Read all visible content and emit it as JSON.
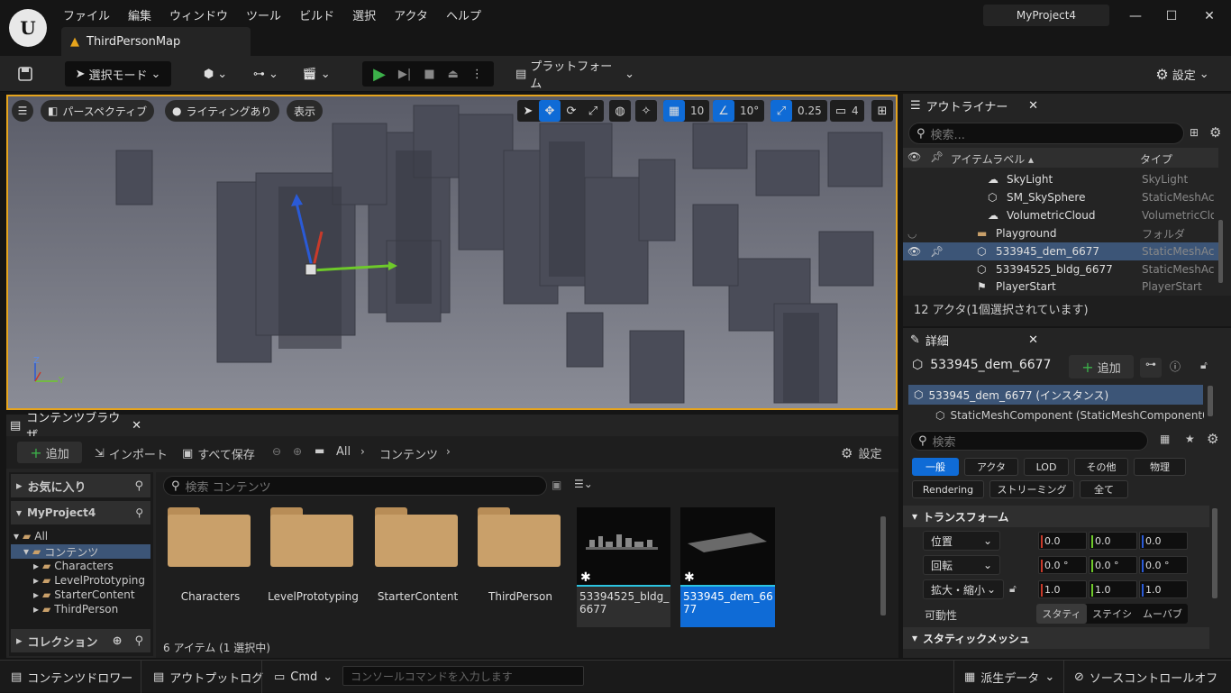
{
  "app": {
    "menu": [
      "ファイル",
      "編集",
      "ウィンドウ",
      "ツール",
      "ビルド",
      "選択",
      "アクタ",
      "ヘルプ"
    ],
    "project": "MyProject4",
    "map_tab": "ThirdPersonMap"
  },
  "toolbar": {
    "mode": "選択モード",
    "platform": "プラットフォーム",
    "settings": "設定"
  },
  "viewport": {
    "perspective": "パースペクティブ",
    "lighting": "ライティングあり",
    "show": "表示",
    "grid_snap": "10",
    "rot_snap": "10°",
    "scale_snap": "0.25",
    "cam_speed": "4",
    "axis_z": "Z",
    "axis_y": "Y"
  },
  "outliner": {
    "title": "アウトライナー",
    "search_placeholder": "検索...",
    "col_label": "アイテムラベル ▴",
    "col_type": "タイプ",
    "rows": [
      {
        "label": "SkyLight",
        "type": "SkyLight"
      },
      {
        "label": "SM_SkySphere",
        "type": "StaticMeshAc"
      },
      {
        "label": "VolumetricCloud",
        "type": "VolumetricClo"
      },
      {
        "label": "Playground",
        "type": "フォルダ"
      },
      {
        "label": "533945_dem_6677",
        "type": "StaticMeshAc"
      },
      {
        "label": "53394525_bldg_6677",
        "type": "StaticMeshAc"
      },
      {
        "label": "PlayerStart",
        "type": "PlayerStart"
      }
    ],
    "status": "12 アクタ(1個選択されています)"
  },
  "details": {
    "title": "詳細",
    "actor": "533945_dem_6677",
    "add": "追加",
    "instance": "533945_dem_6677 (インスタンス)",
    "component": "StaticMeshComponent (StaticMeshComponent0",
    "search_placeholder": "検索",
    "filters": [
      "一般",
      "アクタ",
      "LOD",
      "その他",
      "物理",
      "Rendering",
      "ストリーミング",
      "全て"
    ],
    "transform_header": "トランスフォーム",
    "location_label": "位置",
    "rotation_label": "回転",
    "scale_label": "拡大・縮小",
    "location": [
      "0.0",
      "0.0",
      "0.0"
    ],
    "rotation": [
      "0.0 °",
      "0.0 °",
      "0.0 °"
    ],
    "scale": [
      "1.0",
      "1.0",
      "1.0"
    ],
    "mobility_label": "可動性",
    "mobility": [
      "スタティ",
      "ステイシ",
      "ムーバブ"
    ],
    "static_mesh_header": "スタティックメッシュ"
  },
  "content_browser": {
    "title": "コンテンツブラウザ",
    "add": "追加",
    "import": "インポート",
    "save_all": "すべて保存",
    "path_all": "All",
    "path_content": "コンテンツ",
    "settings": "設定",
    "favorites": "お気に入り",
    "project": "MyProject4",
    "tree": [
      "All",
      "コンテンツ",
      "Characters",
      "LevelPrototyping",
      "StarterContent",
      "ThirdPerson"
    ],
    "collections": "コレクション",
    "search_placeholder": "検索 コンテンツ",
    "items": [
      "Characters",
      "LevelPrototyping",
      "StarterContent",
      "ThirdPerson",
      "53394525_bldg_6677",
      "533945_dem_6677"
    ],
    "item_count": "6 アイテム (1 選択中)"
  },
  "statusbar": {
    "drawer": "コンテンツドロワー",
    "output": "アウトプットログ",
    "cmd": "Cmd",
    "console_placeholder": "コンソールコマンドを入力します",
    "derived": "派生データ",
    "source_control": "ソースコントロールオフ"
  },
  "colors": {
    "accent": "#0f6bd6",
    "viewport_border": "#e6a41c",
    "folder": "#c9a06a"
  }
}
